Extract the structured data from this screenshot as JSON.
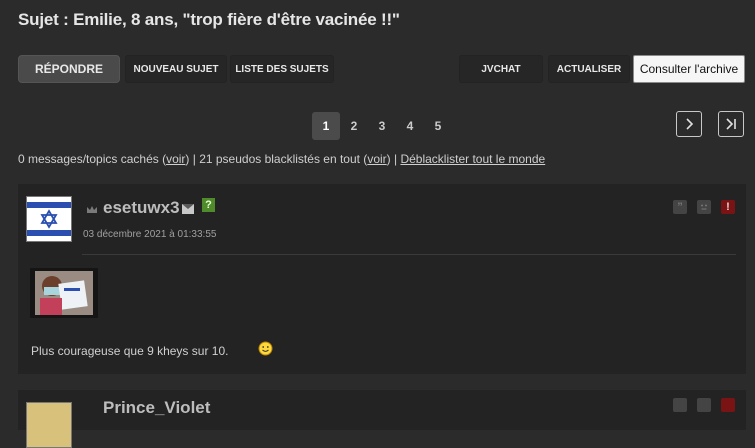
{
  "topic": {
    "title": "Sujet : Emilie, 8 ans, \"trop fière d'être vacinée !!\""
  },
  "toolbar": {
    "reply": "RÉPONDRE",
    "new_topic": "NOUVEAU SUJET",
    "topic_list": "LISTE DES SUJETS",
    "jvchat": "JVCHAT",
    "refresh": "ACTUALISER",
    "archive": "Consulter l'archive"
  },
  "pagination": {
    "pages": [
      "1",
      "2",
      "3",
      "4",
      "5"
    ],
    "current": "1"
  },
  "info": {
    "part1": "0 messages/topics cachés (",
    "voir1": "voir",
    "part2": ") | 21 pseudos blacklistés en tout (",
    "voir2": "voir",
    "part3": ") | ",
    "unblacklist": "Déblacklister tout le monde"
  },
  "post": {
    "author": "esetuwx3",
    "date": "03 décembre 2021 à 01:33:55",
    "message": "Plus courageuse que 9 kheys sur 10.",
    "qmark": "?",
    "quote_glyph": "”",
    "alert_glyph": "!"
  },
  "post2": {
    "author_partial": "Prince_Violet"
  },
  "colors": {
    "background": "#2b2b2b",
    "post_bg": "#232323",
    "accent_green": "#4f8a2b",
    "alert_red": "#7a1414"
  },
  "icons": [
    "crown-icon",
    "mail-icon",
    "quote-icon",
    "smiley-icon",
    "alert-icon",
    "chevron-right-icon",
    "last-page-icon",
    "flag-icon"
  ]
}
